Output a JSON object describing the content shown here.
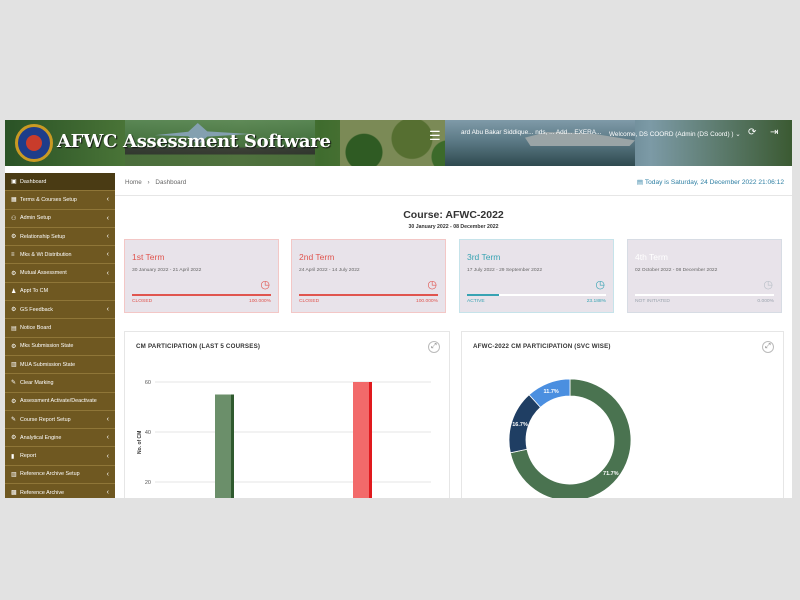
{
  "header": {
    "brand": "AFWC Assessment Software",
    "marquee": "ard Abu Bakar Siddique... nds, ... Add... EXERA...",
    "welcome": "Welcome, DS COORD (Admin (DS Coord) ) ⌄"
  },
  "sidebar": {
    "items": [
      {
        "label": "Dashboard",
        "icon": "dashboard-icon",
        "submenu": false,
        "active": true
      },
      {
        "label": "Terms & Courses Setup",
        "icon": "calendar-icon",
        "submenu": true
      },
      {
        "label": "Admin Setup",
        "icon": "users-icon",
        "submenu": true
      },
      {
        "label": "Relationship Setup",
        "icon": "gear-icon",
        "submenu": true
      },
      {
        "label": "Mks & Wt Distribution",
        "icon": "sliders-icon",
        "submenu": true
      },
      {
        "label": "Mutual Assessment",
        "icon": "gear-icon",
        "submenu": true
      },
      {
        "label": "Appt To CM",
        "icon": "person-icon",
        "submenu": false
      },
      {
        "label": "GS Feedback",
        "icon": "gear-icon",
        "submenu": true
      },
      {
        "label": "Notice Board",
        "icon": "clipboard-icon",
        "submenu": false
      },
      {
        "label": "Mks Submission State",
        "icon": "gear-icon",
        "submenu": false
      },
      {
        "label": "MUA Submission State",
        "icon": "table-icon",
        "submenu": false
      },
      {
        "label": "Clear Marking",
        "icon": "eraser-icon",
        "submenu": false
      },
      {
        "label": "Assessment Activate/Deactivate",
        "icon": "gear-icon",
        "submenu": false
      },
      {
        "label": "Course Report Setup",
        "icon": "pencil-icon",
        "submenu": true
      },
      {
        "label": "Analytical Engine",
        "icon": "gear-icon",
        "submenu": true
      },
      {
        "label": "Report",
        "icon": "chart-icon",
        "submenu": true
      },
      {
        "label": "Reference Archive Setup",
        "icon": "table-icon",
        "submenu": true
      },
      {
        "label": "Reference Archive",
        "icon": "archive-icon",
        "submenu": true
      }
    ]
  },
  "breadcrumb": {
    "home": "Home",
    "current": "Dashboard"
  },
  "date_text": "Today is Saturday, 24 December 2022 21:06:12",
  "course": {
    "title": "Course: AFWC-2022",
    "dates": "30 January 2022 - 08 December 2022"
  },
  "terms": [
    {
      "name": "1st Term",
      "dates": "30 January 2022 - 21 April 2022",
      "status": "CLOSED",
      "pct": "100.000%",
      "progress": 1.0,
      "color": "#e0554f"
    },
    {
      "name": "2nd Term",
      "dates": "24 April 2022 - 14 July 2022",
      "status": "CLOSED",
      "pct": "100.000%",
      "progress": 1.0,
      "color": "#e0554f"
    },
    {
      "name": "3rd Term",
      "dates": "17 July 2022 - 29 September 2022",
      "status": "ACTIVE",
      "pct": "23.188%",
      "progress": 0.23188,
      "color": "#37a3b3"
    },
    {
      "name": "4th Term",
      "dates": "02 October 2022 - 08 December 2022",
      "status": "NOT INITIATED",
      "pct": "0.000%",
      "progress": 0.0,
      "color": "#b9c0c8"
    }
  ],
  "panels": {
    "participation_title": "CM PARTICIPATION (LAST 5 COURSES)",
    "svc_title": "AFWC-2022 CM PARTICIPATION (SVC WISE)"
  },
  "chart_data": [
    {
      "type": "bar",
      "title": "CM PARTICIPATION (LAST 5 COURSES)",
      "ylabel": "No. of CM",
      "yticks": [
        20,
        40,
        60
      ],
      "ylim": [
        0,
        65
      ],
      "bars": [
        {
          "value": 55,
          "color": "#6b8f6a",
          "edge": "#2f5a2e"
        },
        {
          "value": 60,
          "color": "#f26a6a",
          "edge": "#e0191d"
        }
      ]
    },
    {
      "type": "pie",
      "title": "AFWC-2022 CM PARTICIPATION (SVC WISE)",
      "slices": [
        {
          "label": "71.7%",
          "value": 71.7,
          "color": "#4a7350"
        },
        {
          "label": "16.7%",
          "value": 16.7,
          "color": "#1f3e63"
        },
        {
          "label": "11.7%",
          "value": 11.7,
          "color": "#4b8fe0"
        }
      ]
    }
  ],
  "colors": {
    "sidebar": "#7a6227",
    "accent": "#2e7fa3"
  }
}
